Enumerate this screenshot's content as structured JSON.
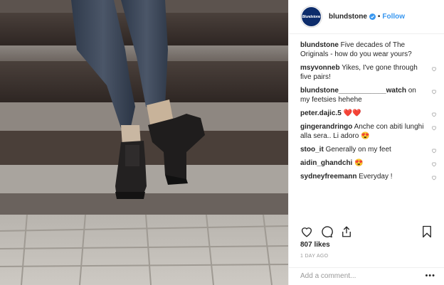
{
  "post": {
    "username": "blundstone",
    "avatar_text": "Blundstone",
    "verified": true,
    "follow_label": "Follow",
    "separator": "•",
    "caption_user": "blundstone",
    "caption_text": "Five decades of The Originals - how do you wear yours?",
    "comments": [
      {
        "user": "msyvonneb",
        "text": "Yikes, I've gone through five pairs!"
      },
      {
        "user": "blundstone____________watch",
        "text": "on my feetsies hehehe"
      },
      {
        "user": "peter.dajic.5",
        "text": "❤️❤️"
      },
      {
        "user": "gingerandringo",
        "text": "Anche con abiti lunghi alla sera.. Li adoro 😍"
      },
      {
        "user": "stoo_it",
        "text": "Generally on my feet"
      },
      {
        "user": "aidin_ghandchi",
        "text": "😍"
      },
      {
        "user": "sydneyfreemann",
        "text": "Everyday !"
      }
    ],
    "likes": "807 likes",
    "time_ago": "1 DAY AGO",
    "comment_placeholder": "Add a comment...",
    "more_label": "•••",
    "icons": [
      "heart-icon",
      "comment-icon",
      "share-icon",
      "bookmark-icon",
      "verified-badge-icon",
      "more-options-icon"
    ],
    "colors": {
      "follow": "#3897f0",
      "text": "#262626",
      "muted": "#999999",
      "brand": "#0d2c6b",
      "heart": "#ed4956"
    }
  }
}
